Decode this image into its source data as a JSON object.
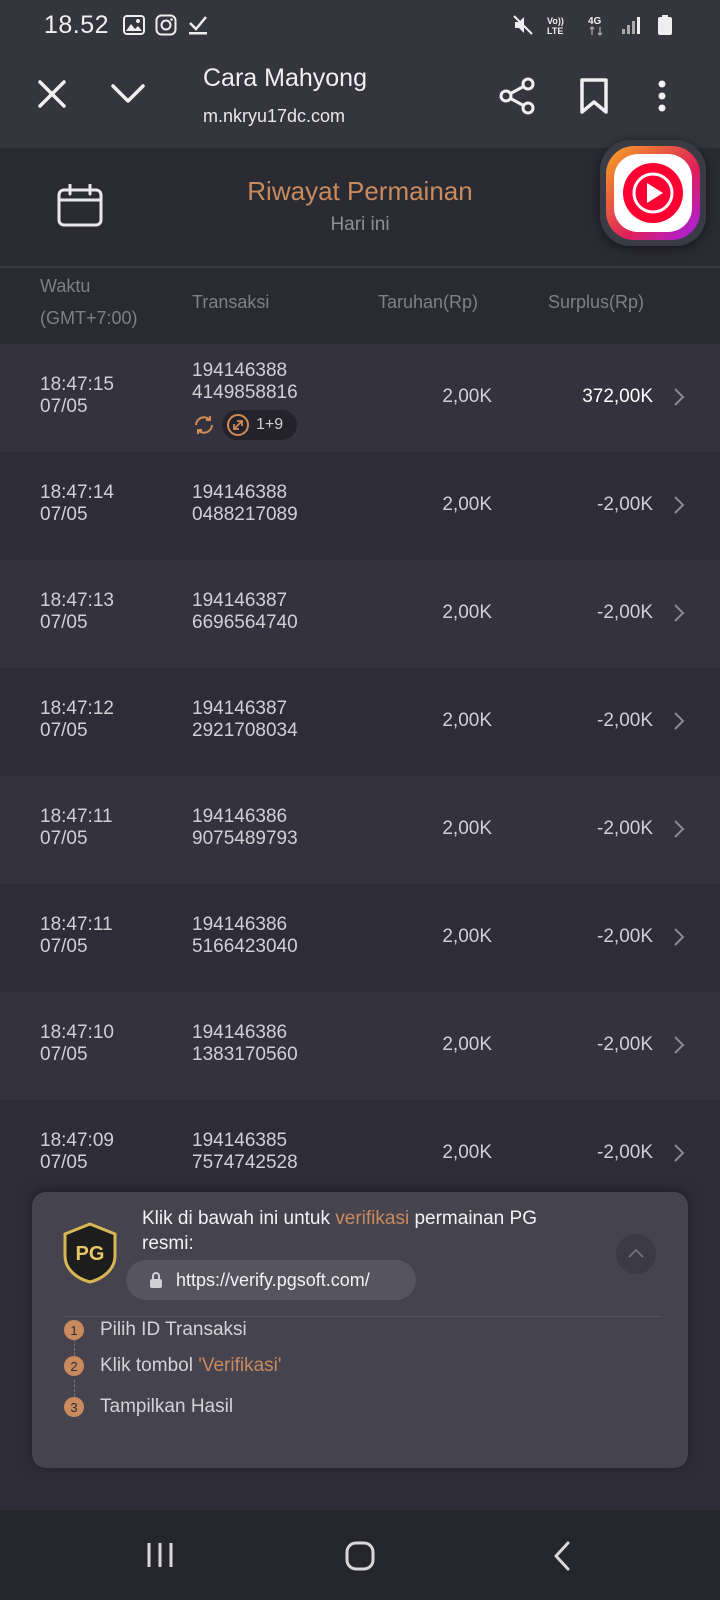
{
  "status_bar": {
    "time": "18.52",
    "left_icons": [
      "gallery-icon",
      "instagram-icon",
      "download-done-icon"
    ],
    "right_icons": [
      "mute-icon",
      "volte-icon",
      "4g-icon",
      "signal-icon",
      "battery-icon"
    ],
    "volte_label": "Vo)) LTE",
    "network_label": "4G"
  },
  "browser": {
    "title": "Cara Mahyong",
    "url": "m.nkryu17dc.com"
  },
  "header": {
    "title": "Riwayat Permainan",
    "subtitle": "Hari ini"
  },
  "table": {
    "columns": {
      "time": "Waktu",
      "timezone": "(GMT+7:00)",
      "transaction": "Transaksi",
      "bet": "Taruhan(Rp)",
      "surplus": "Surplus(Rp)"
    },
    "rows": [
      {
        "time": "18:47:15",
        "date": "07/05",
        "tx1": "194146388",
        "tx2": "4149858816",
        "bet": "2,00K",
        "surplus": "372,00K",
        "tag": "1+9"
      },
      {
        "time": "18:47:14",
        "date": "07/05",
        "tx1": "194146388",
        "tx2": "0488217089",
        "bet": "2,00K",
        "surplus": "-2,00K"
      },
      {
        "time": "18:47:13",
        "date": "07/05",
        "tx1": "194146387",
        "tx2": "6696564740",
        "bet": "2,00K",
        "surplus": "-2,00K"
      },
      {
        "time": "18:47:12",
        "date": "07/05",
        "tx1": "194146387",
        "tx2": "2921708034",
        "bet": "2,00K",
        "surplus": "-2,00K"
      },
      {
        "time": "18:47:11",
        "date": "07/05",
        "tx1": "194146386",
        "tx2": "9075489793",
        "bet": "2,00K",
        "surplus": "-2,00K"
      },
      {
        "time": "18:47:11",
        "date": "07/05",
        "tx1": "194146386",
        "tx2": "5166423040",
        "bet": "2,00K",
        "surplus": "-2,00K"
      },
      {
        "time": "18:47:10",
        "date": "07/05",
        "tx1": "194146386",
        "tx2": "1383170560",
        "bet": "2,00K",
        "surplus": "-2,00K"
      },
      {
        "time": "18:47:09",
        "date": "07/05",
        "tx1": "194146385",
        "tx2": "7574742528",
        "bet": "2,00K",
        "surplus": "-2,00K"
      }
    ]
  },
  "verify": {
    "badge": "PG",
    "text_before": "Klik di bawah ini untuk ",
    "text_highlight": "verifikasi",
    "text_after": " permainan PG resmi:",
    "url": "https://verify.pgsoft.com/",
    "steps": [
      {
        "num": "1",
        "label": "Pilih ID Transaksi"
      },
      {
        "num": "2",
        "label": "Klik tombol ",
        "highlight": "'Verifikasi'"
      },
      {
        "num": "3",
        "label": "Tampilkan Hasil"
      }
    ]
  },
  "colors": {
    "accent": "#c98a5e",
    "background": "#2d2c38",
    "row_alt": "#33323e"
  }
}
